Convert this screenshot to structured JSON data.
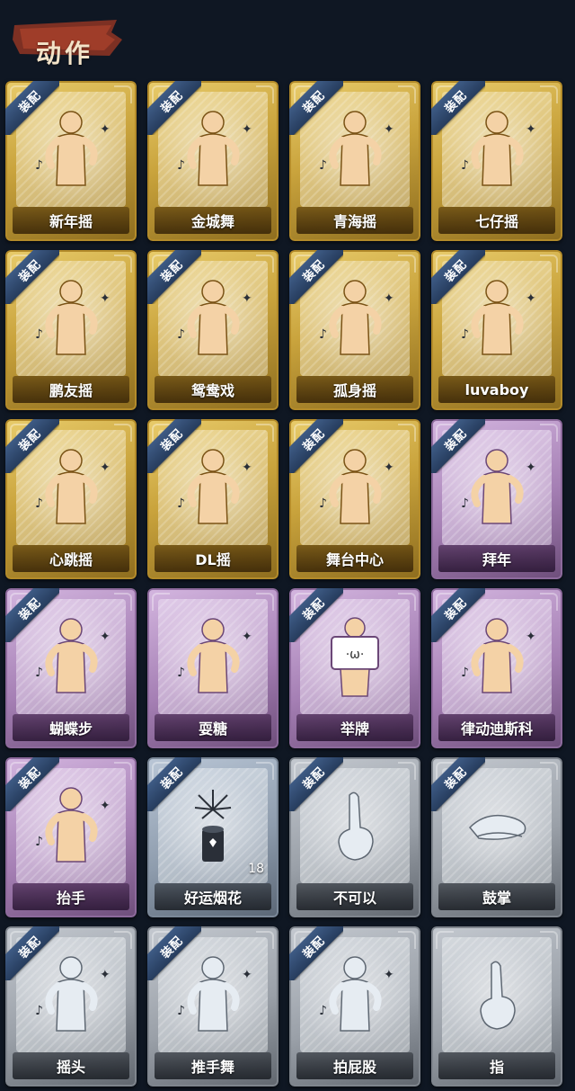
{
  "header": {
    "title": "动作"
  },
  "cards": [
    {
      "label": "新年摇",
      "equipped": true,
      "rarity": "gold",
      "icon": "dancer-shake-icon"
    },
    {
      "label": "金城舞",
      "equipped": true,
      "rarity": "gold",
      "icon": "dancer-wave-icon"
    },
    {
      "label": "青海摇",
      "equipped": true,
      "rarity": "gold",
      "icon": "dancer-cross-arms-icon"
    },
    {
      "label": "七仔摇",
      "equipped": true,
      "rarity": "gold",
      "icon": "dancer-shrug-icon"
    },
    {
      "label": "鹏友摇",
      "equipped": true,
      "rarity": "gold",
      "icon": "dancer-point-icon"
    },
    {
      "label": "鸳鸯戏",
      "equipped": true,
      "rarity": "gold",
      "icon": "dancer-sway-icon"
    },
    {
      "label": "孤身摇",
      "equipped": true,
      "rarity": "gold",
      "icon": "dancer-fists-icon"
    },
    {
      "label": "luvaboy",
      "equipped": true,
      "rarity": "gold",
      "icon": "dancer-cross-arms-icon"
    },
    {
      "label": "心跳摇",
      "equipped": true,
      "rarity": "gold",
      "icon": "dancer-heart-icon"
    },
    {
      "label": "DL摇",
      "equipped": true,
      "rarity": "gold",
      "icon": "dancer-raise-arm-icon"
    },
    {
      "label": "舞台中心",
      "equipped": true,
      "rarity": "gold",
      "icon": "dancer-stage-icon"
    },
    {
      "label": "拜年",
      "equipped": true,
      "rarity": "purple",
      "icon": "greeting-bow-icon"
    },
    {
      "label": "蝴蝶步",
      "equipped": true,
      "rarity": "purple",
      "icon": "dancer-arms-out-icon"
    },
    {
      "label": "耍糖",
      "equipped": false,
      "rarity": "purple",
      "icon": "candy-toss-icon"
    },
    {
      "label": "举牌",
      "equipped": true,
      "rarity": "purple",
      "icon": "hold-sign-icon"
    },
    {
      "label": "律动迪斯科",
      "equipped": true,
      "rarity": "purple",
      "icon": "disco-point-icon"
    },
    {
      "label": "抬手",
      "equipped": true,
      "rarity": "purple",
      "icon": "raise-hand-icon"
    },
    {
      "label": "好运烟花",
      "equipped": true,
      "rarity": "bluegray",
      "icon": "firework-icon",
      "count": "18"
    },
    {
      "label": "不可以",
      "equipped": true,
      "rarity": "silver",
      "icon": "finger-wag-icon"
    },
    {
      "label": "鼓掌",
      "equipped": true,
      "rarity": "silver",
      "icon": "clap-icon"
    },
    {
      "label": "摇头",
      "equipped": true,
      "rarity": "silver",
      "icon": "head-shake-icon"
    },
    {
      "label": "推手舞",
      "equipped": true,
      "rarity": "silver",
      "icon": "push-hands-icon"
    },
    {
      "label": "拍屁股",
      "equipped": true,
      "rarity": "silver",
      "icon": "butt-slap-icon"
    },
    {
      "label": "指",
      "equipped": false,
      "rarity": "silver",
      "icon": "point-finger-icon"
    }
  ],
  "badge_label": "装配"
}
